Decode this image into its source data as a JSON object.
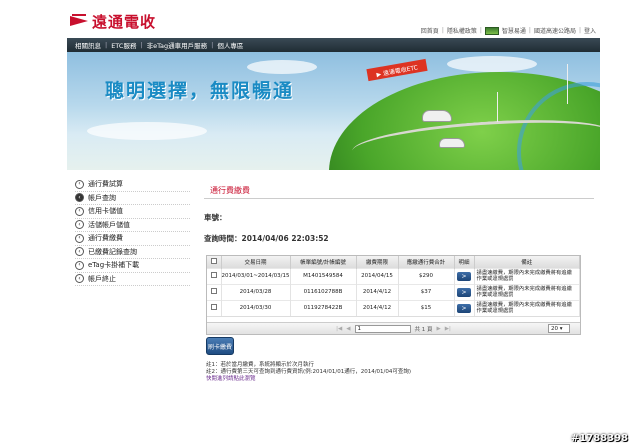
{
  "header": {
    "logo_text": "遠通電收",
    "toplinks": [
      "回首頁",
      "隱私權政策",
      "智慧易通",
      "國道高速公路局",
      "登入"
    ]
  },
  "nav": {
    "items": [
      "相關訊息",
      "ETC服務",
      "非eTag通車用戶服務",
      "個人專區"
    ]
  },
  "banner": {
    "slogan": "聰明選擇，無限暢通",
    "sign_text": "▶ 遠通電收ETC"
  },
  "menu": {
    "items": [
      {
        "label": "通行費試算",
        "active": false
      },
      {
        "label": "帳戶查詢",
        "active": true
      },
      {
        "label": "信用卡儲值",
        "active": false
      },
      {
        "label": "活儲帳戶儲值",
        "active": false
      },
      {
        "label": "通行費繳費",
        "active": false
      },
      {
        "label": "已繳費記錄查詢",
        "active": false
      },
      {
        "label": "eTag卡掛補下載",
        "active": false
      },
      {
        "label": "帳戶終止",
        "active": false
      }
    ]
  },
  "content": {
    "title": "通行費繳費",
    "plate_label": "車號：",
    "query_time_label": "查詢時間：2014/04/06 22:03:52",
    "table": {
      "headers": [
        "",
        "交易日期",
        "帳單編號/計帳編號",
        "繳費期限",
        "應繳通行費合計",
        "明細",
        "備註"
      ],
      "rows": [
        {
          "date": "2014/03/01~2014/03/15",
          "bill_no": "M1401549584",
          "due": "2014/04/15",
          "amount": "$290",
          "detail": ">",
          "note": "請盡速繳費，期限內未完成繳費將有追繳作業或違規處罰"
        },
        {
          "date": "2014/03/28",
          "bill_no": "0116102788B",
          "due": "2014/4/12",
          "amount": "$37",
          "detail": ">",
          "note": "請盡速繳費，期限內未完成繳費將有追繳作業或違規處罰"
        },
        {
          "date": "2014/03/30",
          "bill_no": "0119278422B",
          "due": "2014/4/12",
          "amount": "$15",
          "detail": ">",
          "note": "請盡速繳費，期限內未完成繳費將有追繳作業或違規處罰"
        }
      ]
    },
    "pager": {
      "first": "|◀",
      "prev": "◀",
      "page_value": "1",
      "page_total": "共 1 頁",
      "next": "▶",
      "last": "▶|",
      "page_size": "20"
    },
    "action_button": "刷卡繳費",
    "notes": [
      "註1：若於當月繳費，系統將顯示於次月執行",
      "註2：通行費第三天可查詢到通行費資訊(例:2014/01/01通行，2014/01/04可查詢)"
    ],
    "link": "快閱進列請點此瀏覽"
  },
  "watermark": "#1788398"
}
